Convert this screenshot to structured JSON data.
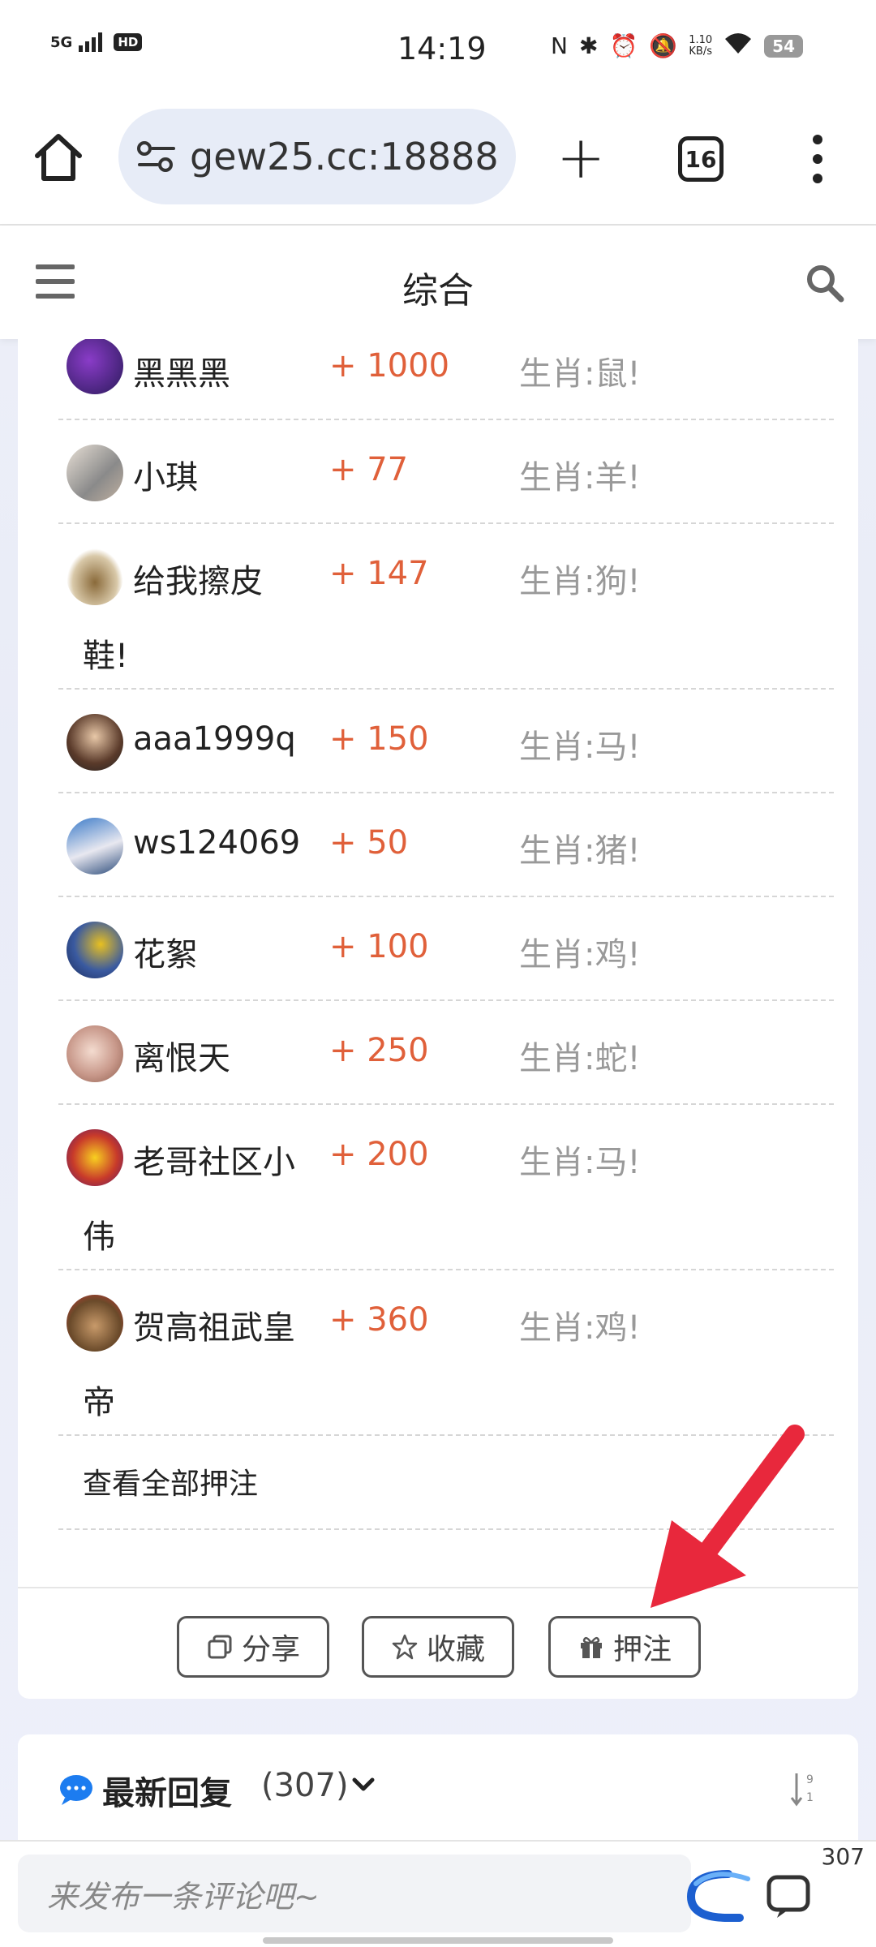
{
  "status_bar": {
    "network": "5G",
    "hd": "HD",
    "time": "14:19",
    "speed_value": "1.10",
    "speed_unit": "KB/s",
    "battery": "54"
  },
  "browser": {
    "url": "gew25.cc:18888",
    "tab_count": "16"
  },
  "header": {
    "title": "综合"
  },
  "bets": [
    {
      "name": "黑黑黑",
      "amount": "+ 1000",
      "pick": "生肖:鼠!",
      "wrap": ""
    },
    {
      "name": "小琪",
      "amount": "+ 77",
      "pick": "生肖:羊!",
      "wrap": ""
    },
    {
      "name": "给我擦皮",
      "amount": "+ 147",
      "pick": "生肖:狗!",
      "wrap": "鞋!"
    },
    {
      "name": "aaa1999q",
      "amount": "+ 150",
      "pick": "生肖:马!",
      "wrap": ""
    },
    {
      "name": "ws124069",
      "amount": "+ 50",
      "pick": "生肖:猪!",
      "wrap": ""
    },
    {
      "name": "花絮",
      "amount": "+ 100",
      "pick": "生肖:鸡!",
      "wrap": ""
    },
    {
      "name": "离恨天",
      "amount": "+ 250",
      "pick": "生肖:蛇!",
      "wrap": ""
    },
    {
      "name": "老哥社区小",
      "amount": "+ 200",
      "pick": "生肖:马!",
      "wrap": "伟"
    },
    {
      "name": "贺高祖武皇",
      "amount": "+ 360",
      "pick": "生肖:鸡!",
      "wrap": "帝"
    }
  ],
  "view_all": "查看全部押注",
  "actions": {
    "share": "分享",
    "favorite": "收藏",
    "bet": "押注"
  },
  "replies": {
    "title": "最新回复",
    "count": "(307)"
  },
  "comment": {
    "placeholder": "来发布一条评论吧~",
    "count": "307"
  },
  "colors": {
    "amount": "#e0603a",
    "pick": "#999999",
    "arrow": "#e8283c",
    "accent": "#1c7cf0"
  }
}
